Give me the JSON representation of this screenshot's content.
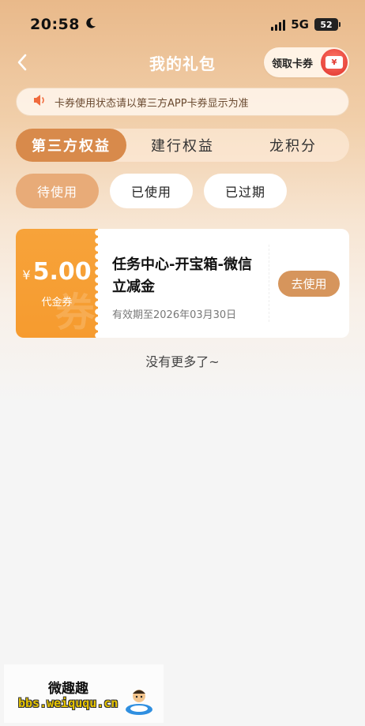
{
  "status_bar": {
    "time": "20:58",
    "network": "5G",
    "battery": "52"
  },
  "nav": {
    "title": "我的礼包",
    "claim_button": "领取卡券",
    "claim_icon_glyph": "¥"
  },
  "notice": {
    "text": "卡券使用状态请以第三方APP卡券显示为准"
  },
  "tabs": [
    {
      "label": "第三方权益",
      "active": true
    },
    {
      "label": "建行权益",
      "active": false
    },
    {
      "label": "龙积分",
      "active": false
    }
  ],
  "filters": [
    {
      "label": "待使用",
      "active": true
    },
    {
      "label": "已使用",
      "active": false
    },
    {
      "label": "已过期",
      "active": false
    }
  ],
  "coupons": [
    {
      "currency": "¥",
      "amount": "5.00",
      "type": "代金券",
      "watermark": "券",
      "title": "任务中心-开宝箱-微信立减金",
      "expiry": "有效期至2026年03月30日",
      "action": "去使用"
    }
  ],
  "list_end_text": "没有更多了~",
  "watermark": {
    "title": "微趣趣",
    "url": "bbs.weiququ.cn"
  },
  "colors": {
    "accent": "#d88a4b",
    "coupon_orange": "#f69b2f",
    "use_button": "#d6955c",
    "chip_active": "#e8ab78"
  },
  "icons": [
    "moon-icon",
    "signal-icon",
    "battery-icon",
    "back-icon",
    "coupon-card-icon",
    "speaker-icon"
  ]
}
